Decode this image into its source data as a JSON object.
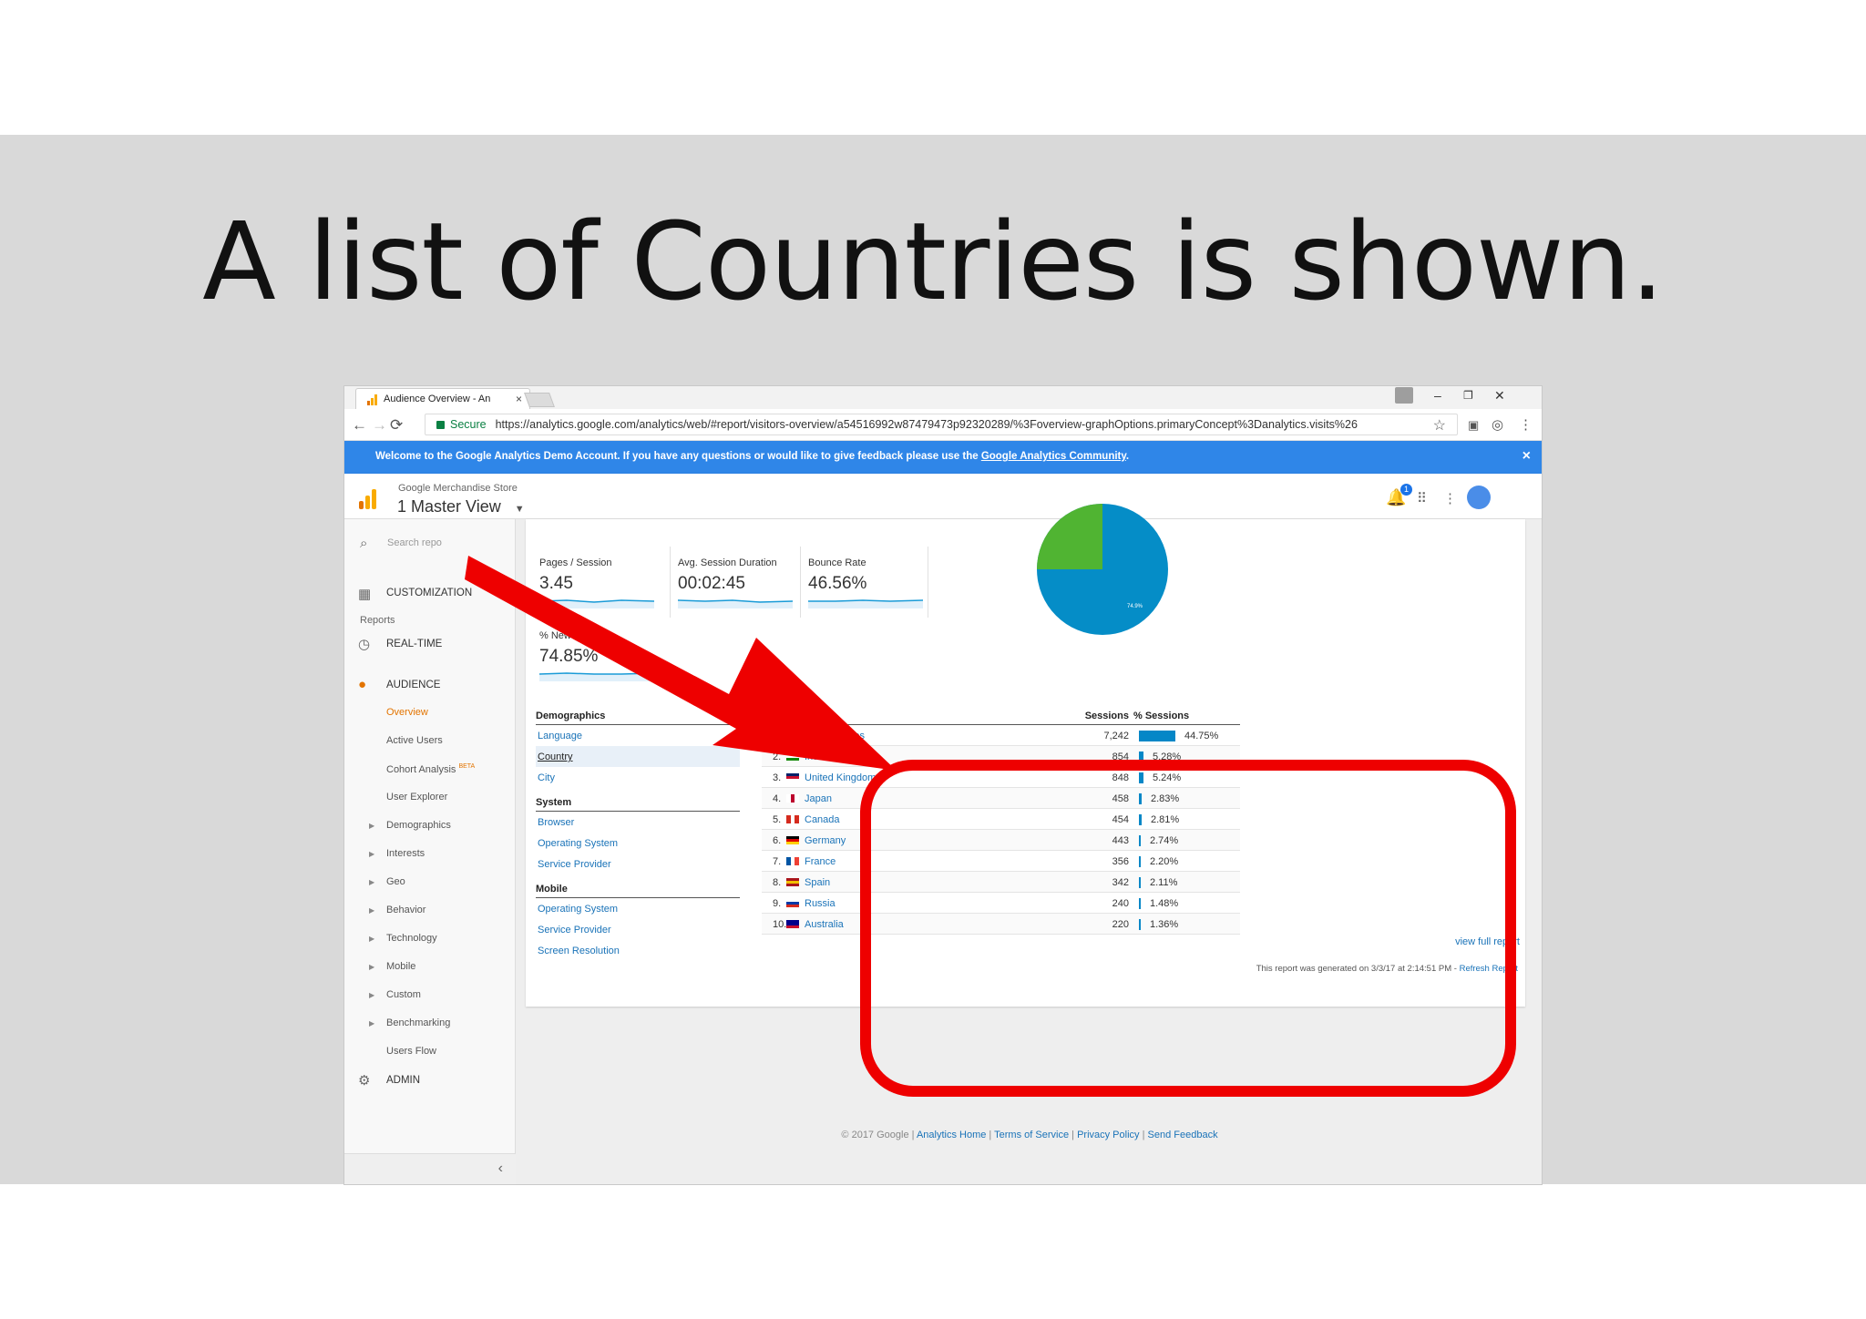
{
  "slide": {
    "title": "A list of Countries is shown."
  },
  "browser": {
    "tab_title": "Audience Overview - An",
    "tab_close": "×",
    "win_min": "–",
    "win_restore": "❐",
    "win_close": "✕",
    "secure_label": "Secure",
    "url": "https://analytics.google.com/analytics/web/#report/visitors-overview/a54516992w87479473p92320289/%3Foverview-graphOptions.primaryConcept%3Danalytics.visits%26"
  },
  "banner": {
    "text": "Welcome to the Google Analytics Demo Account. If you have any questions or would like to give feedback please use the ",
    "link": "Google Analytics Community",
    "end": ".",
    "close": "×"
  },
  "header": {
    "store": "Google Merchandise Store",
    "view": "1 Master View",
    "notification_count": "1"
  },
  "sidebar": {
    "search_placeholder": "Search repo",
    "customization": "CUSTOMIZATION",
    "reports_label": "Reports",
    "realtime": "REAL-TIME",
    "audience": "AUDIENCE",
    "items": [
      "Overview",
      "Active Users",
      "Cohort Analysis",
      "User Explorer",
      "Demographics",
      "Interests",
      "Geo",
      "Behavior",
      "Technology",
      "Mobile",
      "Custom",
      "Benchmarking",
      "Users Flow"
    ],
    "beta": "BETA",
    "admin": "ADMIN",
    "collapse": "‹"
  },
  "metrics": {
    "pages_label": "Pages / Session",
    "pages_value": "3.45",
    "duration_label": "Avg. Session Duration",
    "duration_value": "00:02:45",
    "bounce_label": "Bounce Rate",
    "bounce_value": "46.56%",
    "newsess_label": "% New Sessions",
    "newsess_value": "74.85%",
    "pie_label": "74.9%"
  },
  "dimensions": {
    "demographics": "Demographics",
    "language": "Language",
    "country": "Country",
    "city": "City",
    "system": "System",
    "browser": "Browser",
    "os": "Operating System",
    "provider": "Service Provider",
    "mobile": "Mobile",
    "m_os": "Operating System",
    "m_provider": "Service Provider",
    "m_resolution": "Screen Resolution"
  },
  "country_table": {
    "col_country": "Country",
    "col_sessions": "Sessions",
    "col_pct": "% Sessions",
    "rows": [
      {
        "rank": "1.",
        "name": "United States",
        "sessions": "7,242",
        "pct": "44.75%",
        "share": 44.75
      },
      {
        "rank": "2.",
        "name": "India",
        "sessions": "854",
        "pct": "5.28%",
        "share": 5.28
      },
      {
        "rank": "3.",
        "name": "United Kingdom",
        "sessions": "848",
        "pct": "5.24%",
        "share": 5.24
      },
      {
        "rank": "4.",
        "name": "Japan",
        "sessions": "458",
        "pct": "2.83%",
        "share": 2.83
      },
      {
        "rank": "5.",
        "name": "Canada",
        "sessions": "454",
        "pct": "2.81%",
        "share": 2.81
      },
      {
        "rank": "6.",
        "name": "Germany",
        "sessions": "443",
        "pct": "2.74%",
        "share": 2.74
      },
      {
        "rank": "7.",
        "name": "France",
        "sessions": "356",
        "pct": "2.20%",
        "share": 2.2
      },
      {
        "rank": "8.",
        "name": "Spain",
        "sessions": "342",
        "pct": "2.11%",
        "share": 2.11
      },
      {
        "rank": "9.",
        "name": "Russia",
        "sessions": "240",
        "pct": "1.48%",
        "share": 1.48
      },
      {
        "rank": "10.",
        "name": "Australia",
        "sessions": "220",
        "pct": "1.36%",
        "share": 1.36
      }
    ],
    "view_full": "view full report"
  },
  "report_note": {
    "text": "This report was generated on 3/3/17 at 2:14:51 PM - ",
    "link": "Refresh Report"
  },
  "footer": {
    "copyright": "© 2017 Google | ",
    "home": "Analytics Home",
    "sep": " | ",
    "terms": "Terms of Service",
    "privacy": "Privacy Policy",
    "feedback": "Send Feedback"
  },
  "colors": {
    "accent": "#e37400",
    "link": "#1a73b8",
    "banner": "#2f86e8",
    "annotation": "#ee0000"
  }
}
